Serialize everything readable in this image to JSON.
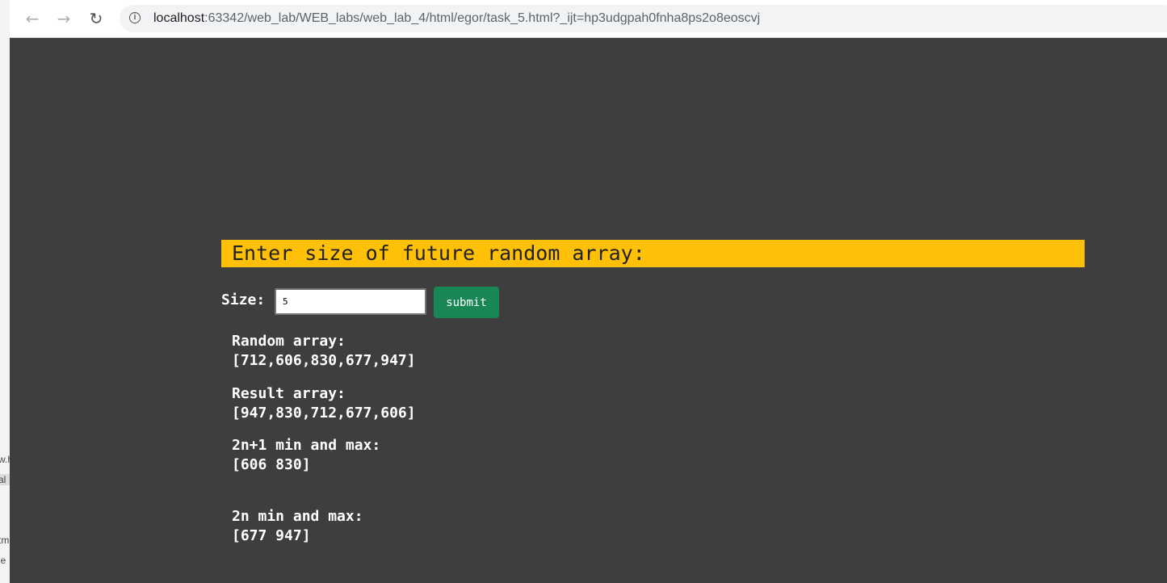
{
  "browser": {
    "url_host": "localhost",
    "url_rest": ":63342/web_lab/WEB_labs/web_lab_4/html/egor/task_5.html?_ijt=hp3udgpah0fnha8ps2o8eoscvj",
    "ext_label": "63"
  },
  "left_strip": {
    "fragments": [
      "w.h",
      "al",
      "tm",
      "ie"
    ]
  },
  "page": {
    "banner_text": "Enter size of future random array:",
    "size_label": "Size:",
    "size_value": "5",
    "submit_label": "submit",
    "random_array_label": "Random array:",
    "random_array_value": "[712,606,830,677,947]",
    "result_array_label": "Result array:",
    "result_array_value": "[947,830,712,677,606]",
    "odd_minmax_label": "2n+1 min and max:",
    "odd_minmax_value": "[606 830]",
    "even_minmax_label": "2n min and max:",
    "even_minmax_value": "[677 947]"
  },
  "colors": {
    "page_background": "#3e3e3e",
    "banner": "#ffc107",
    "submit_button": "#198754"
  }
}
